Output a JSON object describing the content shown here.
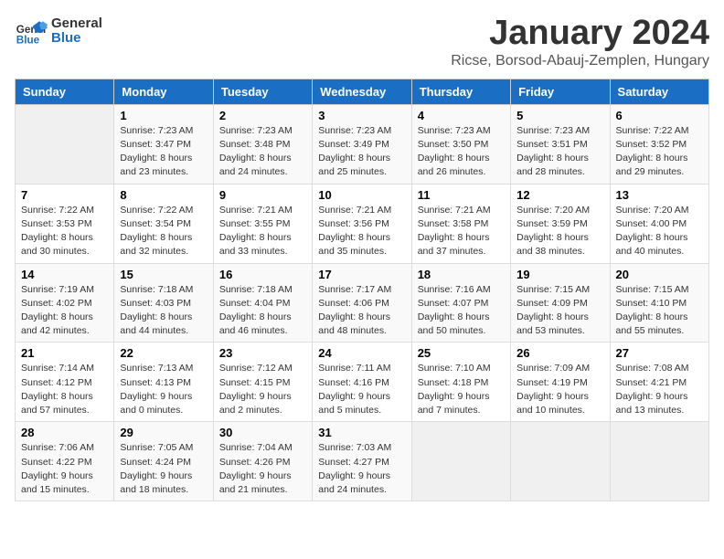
{
  "logo": {
    "line1": "General",
    "line2": "Blue"
  },
  "title": "January 2024",
  "subtitle": "Ricse, Borsod-Abauj-Zemplen, Hungary",
  "headers": [
    "Sunday",
    "Monday",
    "Tuesday",
    "Wednesday",
    "Thursday",
    "Friday",
    "Saturday"
  ],
  "weeks": [
    [
      {
        "num": "",
        "info": ""
      },
      {
        "num": "1",
        "info": "Sunrise: 7:23 AM\nSunset: 3:47 PM\nDaylight: 8 hours\nand 23 minutes."
      },
      {
        "num": "2",
        "info": "Sunrise: 7:23 AM\nSunset: 3:48 PM\nDaylight: 8 hours\nand 24 minutes."
      },
      {
        "num": "3",
        "info": "Sunrise: 7:23 AM\nSunset: 3:49 PM\nDaylight: 8 hours\nand 25 minutes."
      },
      {
        "num": "4",
        "info": "Sunrise: 7:23 AM\nSunset: 3:50 PM\nDaylight: 8 hours\nand 26 minutes."
      },
      {
        "num": "5",
        "info": "Sunrise: 7:23 AM\nSunset: 3:51 PM\nDaylight: 8 hours\nand 28 minutes."
      },
      {
        "num": "6",
        "info": "Sunrise: 7:22 AM\nSunset: 3:52 PM\nDaylight: 8 hours\nand 29 minutes."
      }
    ],
    [
      {
        "num": "7",
        "info": "Sunrise: 7:22 AM\nSunset: 3:53 PM\nDaylight: 8 hours\nand 30 minutes."
      },
      {
        "num": "8",
        "info": "Sunrise: 7:22 AM\nSunset: 3:54 PM\nDaylight: 8 hours\nand 32 minutes."
      },
      {
        "num": "9",
        "info": "Sunrise: 7:21 AM\nSunset: 3:55 PM\nDaylight: 8 hours\nand 33 minutes."
      },
      {
        "num": "10",
        "info": "Sunrise: 7:21 AM\nSunset: 3:56 PM\nDaylight: 8 hours\nand 35 minutes."
      },
      {
        "num": "11",
        "info": "Sunrise: 7:21 AM\nSunset: 3:58 PM\nDaylight: 8 hours\nand 37 minutes."
      },
      {
        "num": "12",
        "info": "Sunrise: 7:20 AM\nSunset: 3:59 PM\nDaylight: 8 hours\nand 38 minutes."
      },
      {
        "num": "13",
        "info": "Sunrise: 7:20 AM\nSunset: 4:00 PM\nDaylight: 8 hours\nand 40 minutes."
      }
    ],
    [
      {
        "num": "14",
        "info": "Sunrise: 7:19 AM\nSunset: 4:02 PM\nDaylight: 8 hours\nand 42 minutes."
      },
      {
        "num": "15",
        "info": "Sunrise: 7:18 AM\nSunset: 4:03 PM\nDaylight: 8 hours\nand 44 minutes."
      },
      {
        "num": "16",
        "info": "Sunrise: 7:18 AM\nSunset: 4:04 PM\nDaylight: 8 hours\nand 46 minutes."
      },
      {
        "num": "17",
        "info": "Sunrise: 7:17 AM\nSunset: 4:06 PM\nDaylight: 8 hours\nand 48 minutes."
      },
      {
        "num": "18",
        "info": "Sunrise: 7:16 AM\nSunset: 4:07 PM\nDaylight: 8 hours\nand 50 minutes."
      },
      {
        "num": "19",
        "info": "Sunrise: 7:15 AM\nSunset: 4:09 PM\nDaylight: 8 hours\nand 53 minutes."
      },
      {
        "num": "20",
        "info": "Sunrise: 7:15 AM\nSunset: 4:10 PM\nDaylight: 8 hours\nand 55 minutes."
      }
    ],
    [
      {
        "num": "21",
        "info": "Sunrise: 7:14 AM\nSunset: 4:12 PM\nDaylight: 8 hours\nand 57 minutes."
      },
      {
        "num": "22",
        "info": "Sunrise: 7:13 AM\nSunset: 4:13 PM\nDaylight: 9 hours\nand 0 minutes."
      },
      {
        "num": "23",
        "info": "Sunrise: 7:12 AM\nSunset: 4:15 PM\nDaylight: 9 hours\nand 2 minutes."
      },
      {
        "num": "24",
        "info": "Sunrise: 7:11 AM\nSunset: 4:16 PM\nDaylight: 9 hours\nand 5 minutes."
      },
      {
        "num": "25",
        "info": "Sunrise: 7:10 AM\nSunset: 4:18 PM\nDaylight: 9 hours\nand 7 minutes."
      },
      {
        "num": "26",
        "info": "Sunrise: 7:09 AM\nSunset: 4:19 PM\nDaylight: 9 hours\nand 10 minutes."
      },
      {
        "num": "27",
        "info": "Sunrise: 7:08 AM\nSunset: 4:21 PM\nDaylight: 9 hours\nand 13 minutes."
      }
    ],
    [
      {
        "num": "28",
        "info": "Sunrise: 7:06 AM\nSunset: 4:22 PM\nDaylight: 9 hours\nand 15 minutes."
      },
      {
        "num": "29",
        "info": "Sunrise: 7:05 AM\nSunset: 4:24 PM\nDaylight: 9 hours\nand 18 minutes."
      },
      {
        "num": "30",
        "info": "Sunrise: 7:04 AM\nSunset: 4:26 PM\nDaylight: 9 hours\nand 21 minutes."
      },
      {
        "num": "31",
        "info": "Sunrise: 7:03 AM\nSunset: 4:27 PM\nDaylight: 9 hours\nand 24 minutes."
      },
      {
        "num": "",
        "info": ""
      },
      {
        "num": "",
        "info": ""
      },
      {
        "num": "",
        "info": ""
      }
    ]
  ]
}
